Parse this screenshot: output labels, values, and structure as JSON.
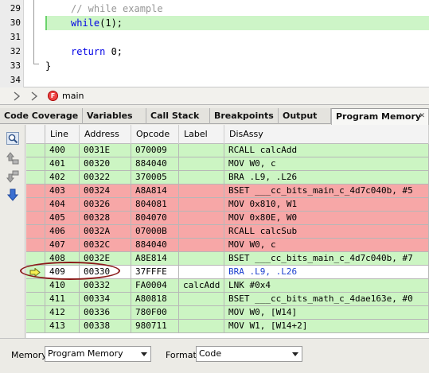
{
  "editor": {
    "lines": [
      {
        "num": "29",
        "parts": [
          {
            "t": "// while example",
            "c": "tok-comment"
          }
        ]
      },
      {
        "num": "30",
        "parts": [
          {
            "t": "while",
            "c": "tok-kw"
          },
          {
            "t": "(1);",
            "c": "tok-num"
          }
        ],
        "highlight": true
      },
      {
        "num": "31",
        "parts": []
      },
      {
        "num": "32",
        "parts": [
          {
            "t": "return",
            "c": "tok-kw"
          },
          {
            "t": " 0;",
            "c": "tok-num"
          }
        ]
      },
      {
        "num": "33",
        "parts": [],
        "closing": "}"
      },
      {
        "num": "34",
        "parts": []
      }
    ]
  },
  "breadcrumb": {
    "function_badge": "F",
    "function_name": "main"
  },
  "tabs": [
    {
      "label": "Code Coverage"
    },
    {
      "label": "Variables"
    },
    {
      "label": "Call Stack"
    },
    {
      "label": "Breakpoints"
    },
    {
      "label": "Output"
    },
    {
      "label": "Program Memory",
      "active": true,
      "close": "✕"
    }
  ],
  "table": {
    "columns": [
      "Line",
      "Address",
      "Opcode",
      "Label",
      "DisAssy"
    ],
    "rows": [
      {
        "line": "400",
        "address": "0031E",
        "opcode": "070009",
        "label": "",
        "disassy": "RCALL calcAdd",
        "state": "green"
      },
      {
        "line": "401",
        "address": "00320",
        "opcode": "884040",
        "label": "",
        "disassy": "MOV W0, c",
        "state": "green"
      },
      {
        "line": "402",
        "address": "00322",
        "opcode": "370005",
        "label": "",
        "disassy": "BRA .L9, .L26",
        "state": "green"
      },
      {
        "line": "403",
        "address": "00324",
        "opcode": "A8A814",
        "label": "",
        "disassy": "BSET ___cc_bits_main_c_4d7c040b, #5",
        "state": "red"
      },
      {
        "line": "404",
        "address": "00326",
        "opcode": "804081",
        "label": "",
        "disassy": "MOV 0x810, W1",
        "state": "red"
      },
      {
        "line": "405",
        "address": "00328",
        "opcode": "804070",
        "label": "",
        "disassy": "MOV 0x80E, W0",
        "state": "red"
      },
      {
        "line": "406",
        "address": "0032A",
        "opcode": "07000B",
        "label": "",
        "disassy": "RCALL calcSub",
        "state": "red"
      },
      {
        "line": "407",
        "address": "0032C",
        "opcode": "884040",
        "label": "",
        "disassy": "MOV W0, c",
        "state": "red"
      },
      {
        "line": "408",
        "address": "0032E",
        "opcode": "A8E814",
        "label": "",
        "disassy": "BSET ___cc_bits_main_c_4d7c040b, #7",
        "state": "green"
      },
      {
        "line": "409",
        "address": "00330",
        "opcode": "37FFFE",
        "label": "",
        "disassy": "BRA .L9, .L26",
        "state": "current"
      },
      {
        "line": "410",
        "address": "00332",
        "opcode": "FA0004",
        "label": "calcAdd",
        "disassy": "LNK #0x4",
        "state": "green"
      },
      {
        "line": "411",
        "address": "00334",
        "opcode": "A80818",
        "label": "",
        "disassy": "BSET ___cc_bits_math_c_4dae163e, #0",
        "state": "green"
      },
      {
        "line": "412",
        "address": "00336",
        "opcode": "780F00",
        "label": "",
        "disassy": "MOV W0, [W14]",
        "state": "green"
      },
      {
        "line": "413",
        "address": "00338",
        "opcode": "980711",
        "label": "",
        "disassy": "MOV W1, [W14+2]",
        "state": "green"
      }
    ]
  },
  "bottom": {
    "memory_label": "Memory",
    "memory_value": "Program Memory",
    "format_label": "Format",
    "format_value": "Code"
  },
  "colors": {
    "covered": "#ccf5c3",
    "not_covered": "#f7a7a7",
    "current_line": "#ffffff",
    "callout": "#8b1a1a"
  }
}
